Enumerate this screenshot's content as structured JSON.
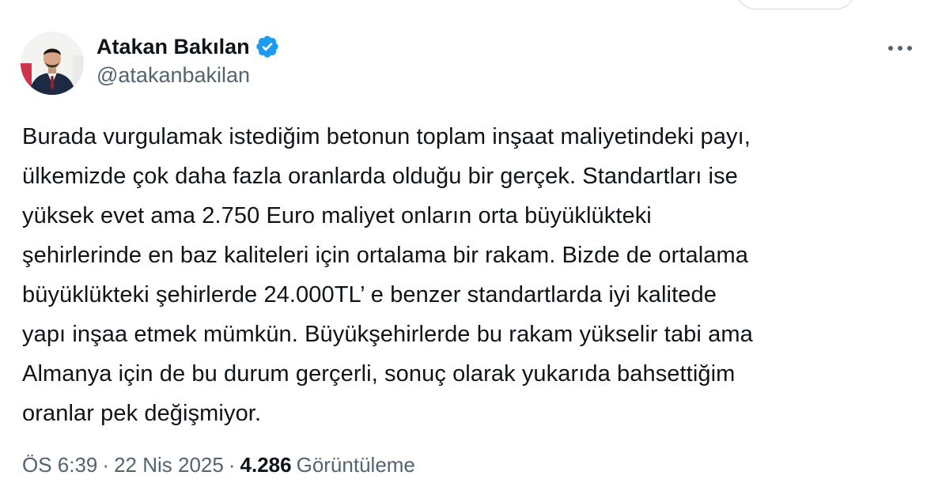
{
  "author": {
    "display_name": "Atakan Bakılan",
    "handle": "@atakanbakilan",
    "verified": true,
    "verified_color": "#1d9bf0"
  },
  "tweet": {
    "text": "Burada vurgulamak istediğim betonun toplam inşaat maliyetindeki payı,\nülkemizde çok daha fazla oranlarda olduğu bir gerçek. Standartları ise\nyüksek evet ama 2.750 Euro maliyet onların orta büyüklükteki\nşehirlerinde en baz kaliteleri için ortalama bir rakam. Bizde de ortalama\nbüyüklükteki şehirlerde 24.000TL’ e benzer standartlarda iyi kalitede\nyapı inşaa etmek mümkün. Büyükşehirlerde bu rakam yükselir tabi ama\nAlmanya için de bu durum gerçerli, sonuç olarak yukarıda bahsettiğim\noranlar pek değişmiyor."
  },
  "meta": {
    "time": "ÖS 6:39",
    "separator": "·",
    "date": "22 Nis 2025",
    "views_count": "4.286",
    "views_label": "Görüntüleme"
  },
  "icons": {
    "more": "more-horizontal-icon",
    "verified": "verified-badge-icon"
  }
}
